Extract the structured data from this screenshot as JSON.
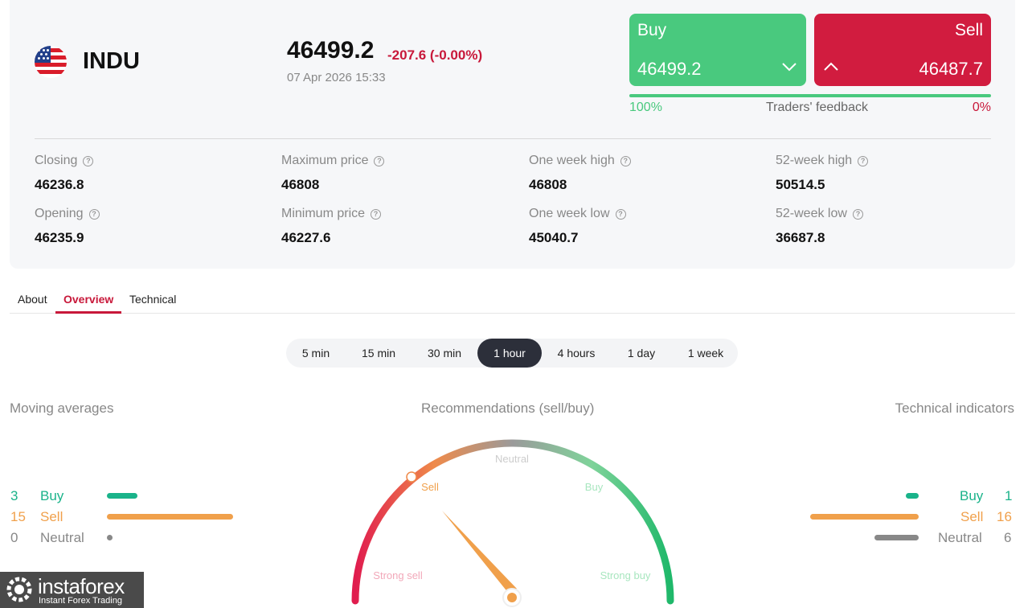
{
  "instrument": {
    "symbol": "INDU",
    "flag_icon": "us-flag-icon"
  },
  "quote": {
    "price": "46499.2",
    "change": "-207.6 (-0.00%)",
    "datetime": "07 Apr 2026 15:33"
  },
  "trade": {
    "buy_label": "Buy",
    "buy_price": "46499.2",
    "sell_label": "Sell",
    "sell_price": "46487.7",
    "buy_color": "#49c97e",
    "sell_color": "#d11c3f"
  },
  "feedback": {
    "buy_pct": "100%",
    "label": "Traders' feedback",
    "sell_pct": "0%",
    "buy_fraction": 1.0
  },
  "stats": [
    {
      "label": "Closing",
      "value": "46236.8"
    },
    {
      "label": "Maximum price",
      "value": "46808"
    },
    {
      "label": "One week high",
      "value": "46808"
    },
    {
      "label": "52-week high",
      "value": "50514.5"
    },
    {
      "label": "Opening",
      "value": "46235.9"
    },
    {
      "label": "Minimum price",
      "value": "46227.6"
    },
    {
      "label": "One week low",
      "value": "45040.7"
    },
    {
      "label": "52-week low",
      "value": "36687.8"
    }
  ],
  "tabs": [
    {
      "label": "About",
      "active": false
    },
    {
      "label": "Overview",
      "active": true
    },
    {
      "label": "Technical",
      "active": false
    }
  ],
  "timeframes": [
    {
      "label": "5 min",
      "selected": false
    },
    {
      "label": "15 min",
      "selected": false
    },
    {
      "label": "30 min",
      "selected": false
    },
    {
      "label": "1 hour",
      "selected": true
    },
    {
      "label": "4 hours",
      "selected": false
    },
    {
      "label": "1 day",
      "selected": false
    },
    {
      "label": "1 week",
      "selected": false
    }
  ],
  "moving_averages": {
    "title": "Moving averages",
    "rows": [
      {
        "count": "3",
        "label": "Buy",
        "color": "#1ab38a"
      },
      {
        "count": "15",
        "label": "Sell",
        "color": "#f0a04b"
      },
      {
        "count": "0",
        "label": "Neutral",
        "color": "#888888"
      }
    ]
  },
  "technical_indicators": {
    "title": "Technical indicators",
    "rows": [
      {
        "count": "1",
        "label": "Buy",
        "color": "#1ab38a"
      },
      {
        "count": "16",
        "label": "Sell",
        "color": "#f0a04b"
      },
      {
        "count": "6",
        "label": "Neutral",
        "color": "#888888"
      }
    ]
  },
  "gauge": {
    "title": "Recommendations (sell/buy)",
    "labels": {
      "strong_sell": "Strong sell",
      "sell": "Sell",
      "neutral": "Neutral",
      "buy": "Buy",
      "strong_buy": "Strong buy"
    },
    "current": "Sell"
  },
  "logo": {
    "name": "instaforex",
    "tagline": "Instant Forex Trading"
  }
}
